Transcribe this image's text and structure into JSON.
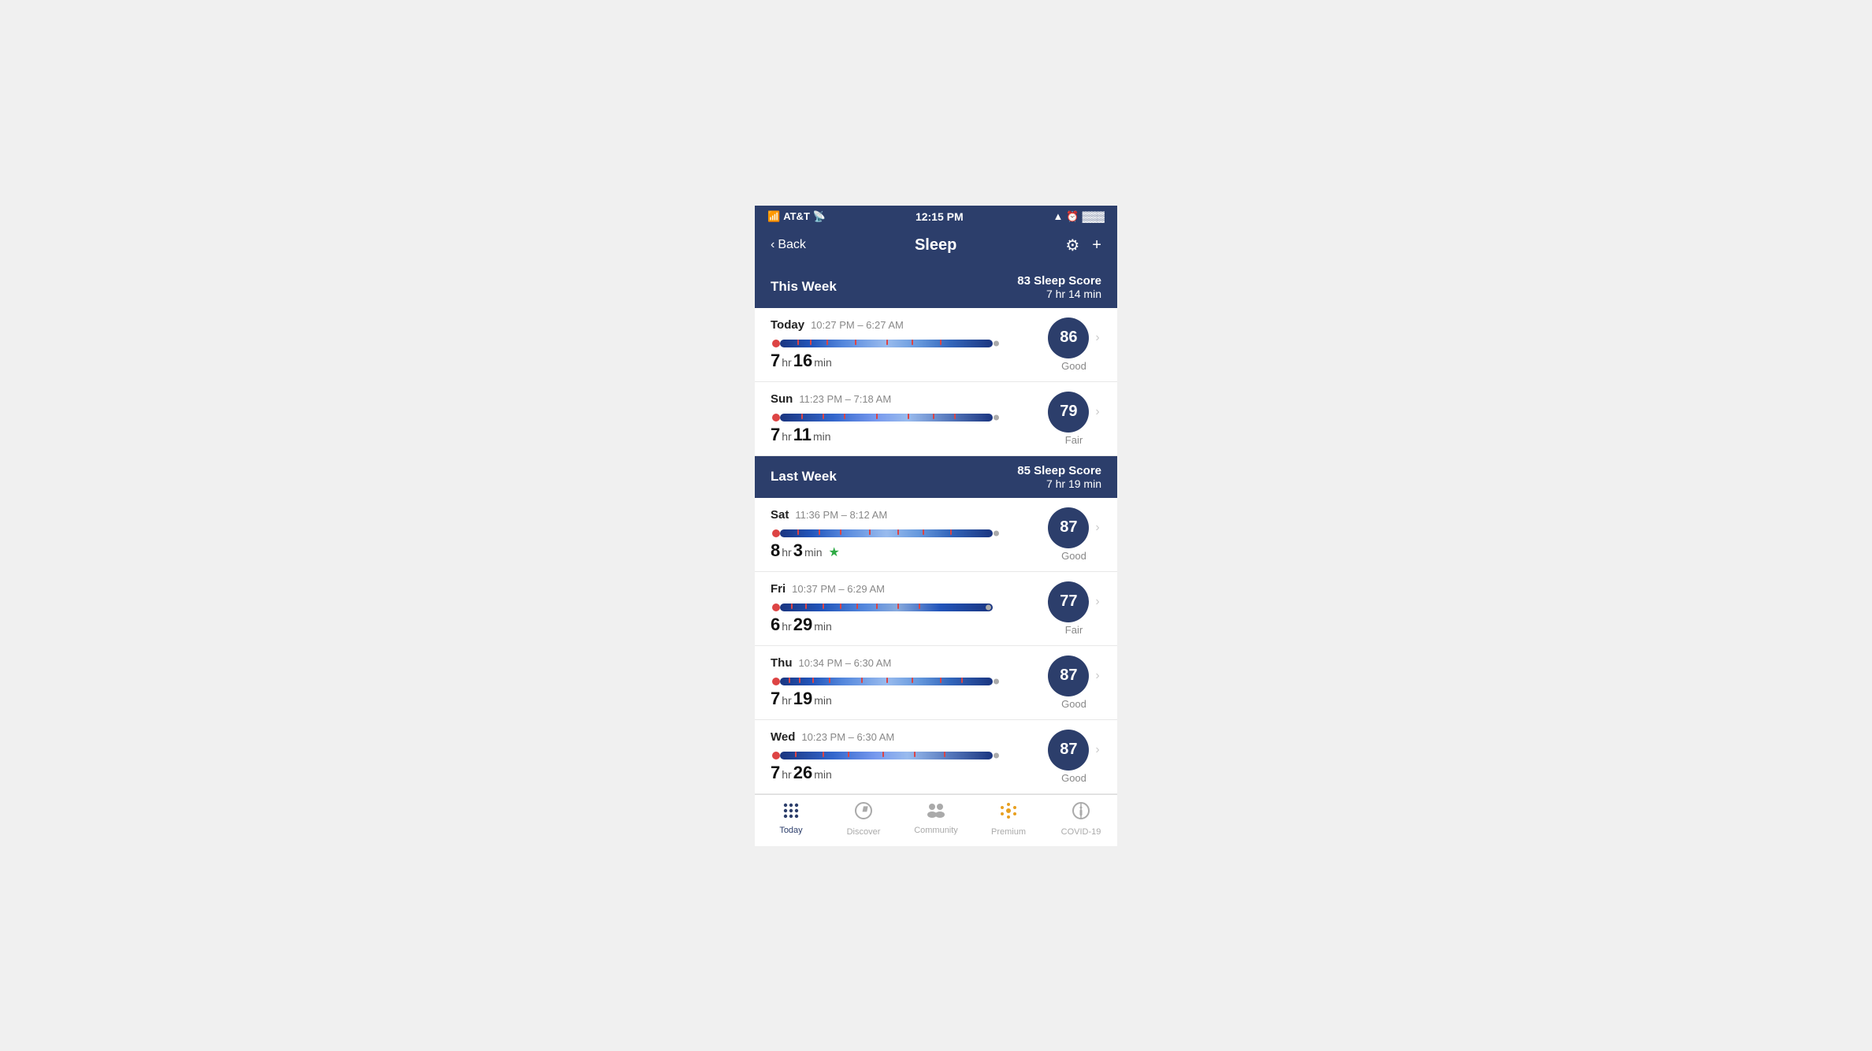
{
  "statusBar": {
    "carrier": "AT&T",
    "time": "12:15 PM",
    "signal": "▲",
    "battery": "🔋"
  },
  "nav": {
    "backLabel": "Back",
    "title": "Sleep",
    "settingsIcon": "⚙",
    "addIcon": "+"
  },
  "thisWeek": {
    "title": "This Week",
    "sleepScore": "83 Sleep Score",
    "avgDuration": "7 hr 14 min",
    "entries": [
      {
        "day": "Today",
        "timeRange": "10:27 PM – 6:27 AM",
        "durationHr": "7",
        "durationMin": "16",
        "score": "86",
        "rating": "Good",
        "hasStar": false
      },
      {
        "day": "Sun",
        "timeRange": "11:23 PM – 7:18 AM",
        "durationHr": "7",
        "durationMin": "11",
        "score": "79",
        "rating": "Fair",
        "hasStar": false
      }
    ]
  },
  "lastWeek": {
    "title": "Last Week",
    "sleepScore": "85 Sleep Score",
    "avgDuration": "7 hr 19 min",
    "entries": [
      {
        "day": "Sat",
        "timeRange": "11:36 PM – 8:12 AM",
        "durationHr": "8",
        "durationMin": "3",
        "score": "87",
        "rating": "Good",
        "hasStar": true
      },
      {
        "day": "Fri",
        "timeRange": "10:37 PM – 6:29 AM",
        "durationHr": "6",
        "durationMin": "29",
        "score": "77",
        "rating": "Fair",
        "hasStar": false
      },
      {
        "day": "Thu",
        "timeRange": "10:34 PM – 6:30 AM",
        "durationHr": "7",
        "durationMin": "19",
        "score": "87",
        "rating": "Good",
        "hasStar": false
      },
      {
        "day": "Wed",
        "timeRange": "10:23 PM – 6:30 AM",
        "durationHr": "7",
        "durationMin": "26",
        "score": "87",
        "rating": "Good",
        "hasStar": false
      }
    ]
  },
  "tabBar": {
    "tabs": [
      {
        "id": "today",
        "label": "Today",
        "active": true
      },
      {
        "id": "discover",
        "label": "Discover",
        "active": false
      },
      {
        "id": "community",
        "label": "Community",
        "active": false
      },
      {
        "id": "premium",
        "label": "Premium",
        "active": false
      },
      {
        "id": "covid19",
        "label": "COVID-19",
        "active": false
      }
    ]
  }
}
